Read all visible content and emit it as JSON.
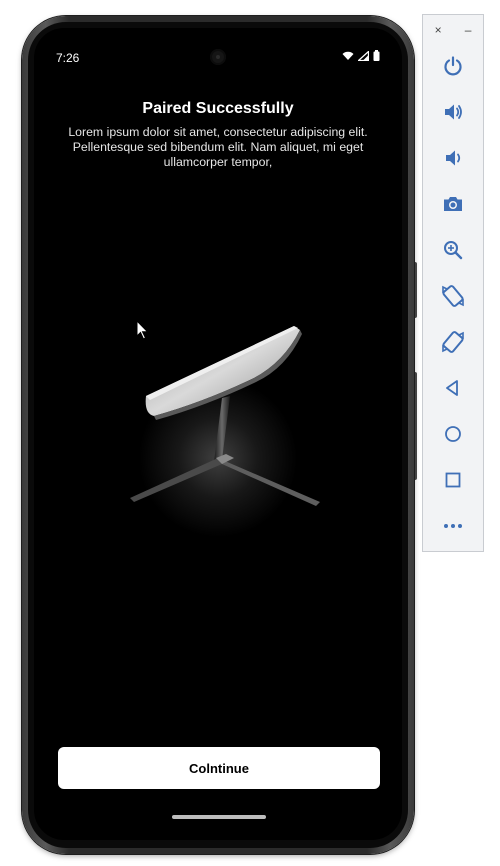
{
  "statusbar": {
    "time": "7:26",
    "icons": [
      "wifi-icon",
      "cellular-icon",
      "battery-icon"
    ]
  },
  "screen": {
    "title": "Paired Successfully",
    "description": "Lorem ipsum dolor sit amet, consectetur adipiscing elit. Pellentesque sed bibendum elit. Nam aliquet, mi eget ullamcorper tempor,",
    "continue_label": "Colntinue"
  },
  "toolbar": {
    "close_label": "×",
    "minimize_label": "–",
    "buttons": [
      "power-icon",
      "volume-up-icon",
      "volume-down-icon",
      "camera-icon",
      "zoom-icon",
      "rotate-left-icon",
      "rotate-right-icon",
      "back-icon",
      "home-icon",
      "overview-icon",
      "more-icon"
    ]
  },
  "colors": {
    "screen_bg": "#000000",
    "button_bg": "#ffffff",
    "toolbar_icon": "#3f6fb6"
  }
}
